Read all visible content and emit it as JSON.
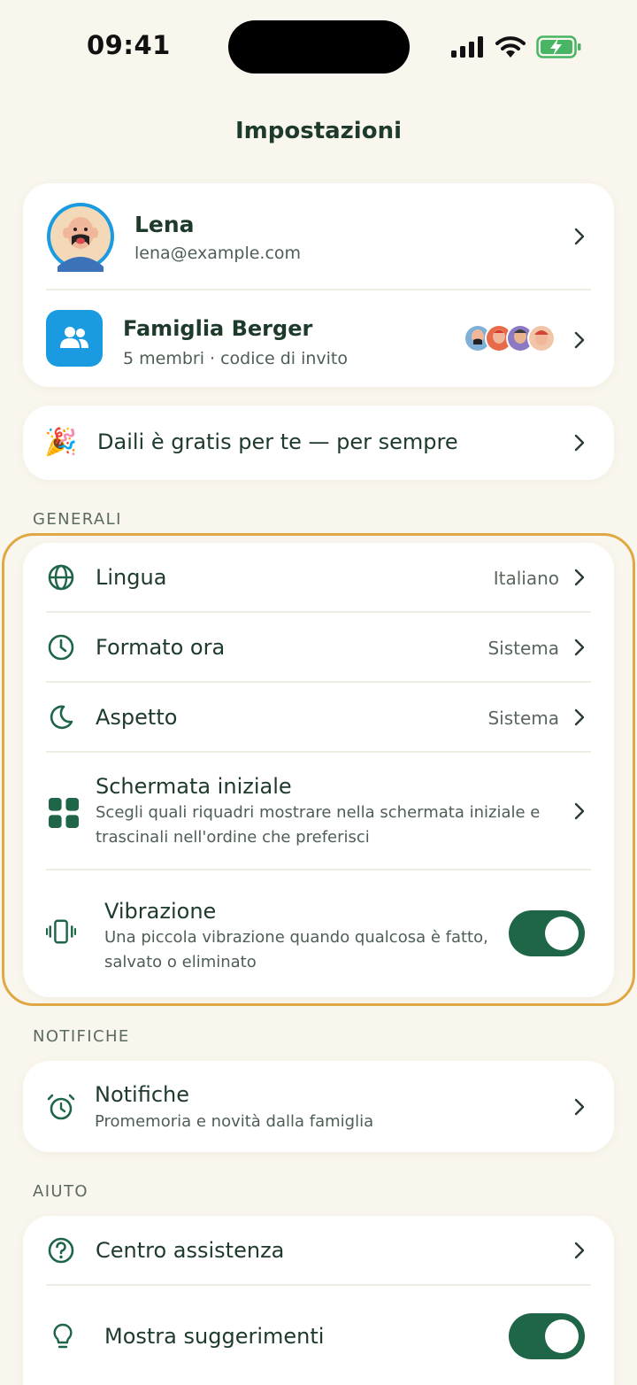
{
  "status_bar": {
    "time": "09:41"
  },
  "page_title": "Impostazioni",
  "profile": {
    "name": "Lena",
    "email": "lena@example.com"
  },
  "family": {
    "name": "Famiglia Berger",
    "subtitle": "5 membri · codice di invito"
  },
  "promo": {
    "emoji": "🎉",
    "text": "Daili è gratis per te — per sempre"
  },
  "sections": {
    "general": {
      "header": "GENERALI",
      "language": {
        "label": "Lingua",
        "value": "Italiano"
      },
      "time_format": {
        "label": "Formato ora",
        "value": "Sistema"
      },
      "appearance": {
        "label": "Aspetto",
        "value": "Sistema"
      },
      "home_screen": {
        "label": "Schermata iniziale",
        "description": "Scegli quali riquadri mostrare nella schermata iniziale e trascinali nell'ordine che preferisci"
      },
      "vibration": {
        "label": "Vibrazione",
        "description": "Una piccola vibrazione quando qualcosa è fatto, salvato o eliminato",
        "enabled": true
      }
    },
    "notifications": {
      "header": "NOTIFICHE",
      "item": {
        "label": "Notifiche",
        "description": "Promemoria e novità dalla famiglia"
      }
    },
    "help": {
      "header": "AIUTO",
      "help_center": {
        "label": "Centro assistenza"
      },
      "tips": {
        "label": "Mostra suggerimenti",
        "enabled": true
      }
    }
  },
  "colors": {
    "background": "#f9f6ed",
    "accent_green": "#1f6548",
    "family_blue": "#1a9ae0",
    "highlight_border": "#e0a844"
  }
}
